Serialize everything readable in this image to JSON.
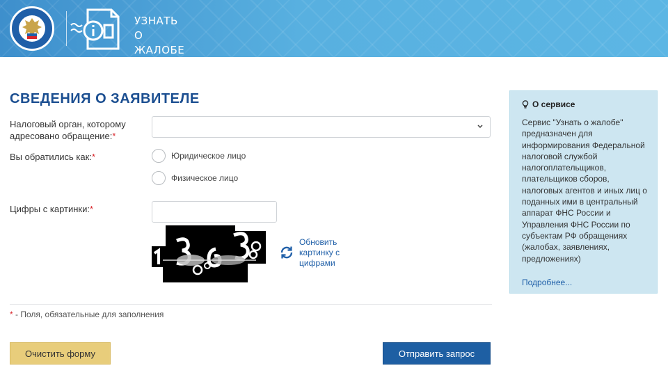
{
  "header": {
    "title_lines": [
      "УЗНАТЬ",
      "О",
      "ЖАЛОБЕ"
    ],
    "emblem_icon": "fns-emblem-icon",
    "service_icon": "info-document-icon"
  },
  "form": {
    "section_title": "СВЕДЕНИЯ О ЗАЯВИТЕЛЕ",
    "tax_authority": {
      "label_line1": "Налоговый орган, которому",
      "label_line2": "адресовано обращение:",
      "required_mark": "*",
      "value": ""
    },
    "applicant_type": {
      "label": "Вы обратились как:",
      "required_mark": "*",
      "options": [
        "Юридическое лицо",
        "Физическое лицо"
      ]
    },
    "captcha": {
      "label": "Цифры с картинки:",
      "required_mark": "*",
      "value": "",
      "refresh_label": "Обновить картинку с цифрами"
    },
    "required_note_mark": "*",
    "required_note": " - Поля, обязательные для заполнения",
    "buttons": {
      "clear": "Очистить форму",
      "submit": "Отправить запрос"
    }
  },
  "info": {
    "title": "О сервисе",
    "text": "Сервис \"Узнать о жалобе\" предназначен для информирования Федеральной налоговой службой налогоплательщиков, плательщиков сборов, налоговых агентов и иных лиц о поданных ими в центральный аппарат ФНС России и Управления ФНС России по субъектам РФ обращениях (жалобах, заявлениях, предложениях)",
    "more_link": "Подробнее..."
  },
  "colors": {
    "header_blue": "#4a9fd6",
    "title_blue": "#1c4f91",
    "required_red": "#d9262b",
    "clear_button": "#e8cd7b",
    "submit_button": "#1e5fa3",
    "info_panel": "#cde6f1"
  }
}
